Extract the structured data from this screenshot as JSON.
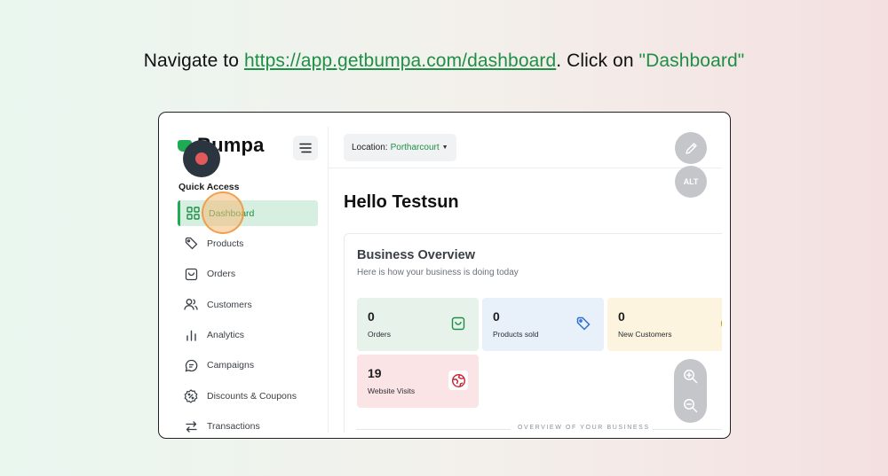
{
  "instruction": {
    "prefix": "Navigate to ",
    "url": "https://app.getbumpa.com/dashboard",
    "middle": ". Click on ",
    "target": "\"Dashboard\""
  },
  "brand": {
    "name": "Bumpa",
    "accent": "#1faa54"
  },
  "sidebar": {
    "section_label": "Quick Access",
    "items": [
      {
        "label": "Dashboard",
        "icon": "grid-icon",
        "active": true
      },
      {
        "label": "Products",
        "icon": "tag-icon"
      },
      {
        "label": "Orders",
        "icon": "bag-icon"
      },
      {
        "label": "Customers",
        "icon": "users-icon"
      },
      {
        "label": "Analytics",
        "icon": "bar-chart-icon"
      },
      {
        "label": "Campaigns",
        "icon": "chat-icon"
      },
      {
        "label": "Discounts & Coupons",
        "icon": "discount-icon"
      },
      {
        "label": "Transactions",
        "icon": "transfer-icon"
      }
    ]
  },
  "topbar": {
    "location_label": "Location:",
    "location_value": "Portharcourt"
  },
  "fab": {
    "alt_label": "ALT"
  },
  "greeting": "Hello Testsun",
  "overview": {
    "title": "Business Overview",
    "subtitle": "Here is how your business is doing today",
    "stats": [
      {
        "value": "0",
        "label": "Orders",
        "icon": "bag-icon",
        "color": "#e6f2ea"
      },
      {
        "value": "0",
        "label": "Products sold",
        "icon": "tag-icon",
        "color": "#e8f0fa"
      },
      {
        "value": "0",
        "label": "New Customers",
        "icon": "smile-icon",
        "color": "#fcf4de"
      },
      {
        "value": "19",
        "label": "Website Visits",
        "icon": "globe-icon",
        "color": "#fbe4e6"
      }
    ],
    "section_caption": "OVERVIEW OF YOUR BUSINESS"
  }
}
